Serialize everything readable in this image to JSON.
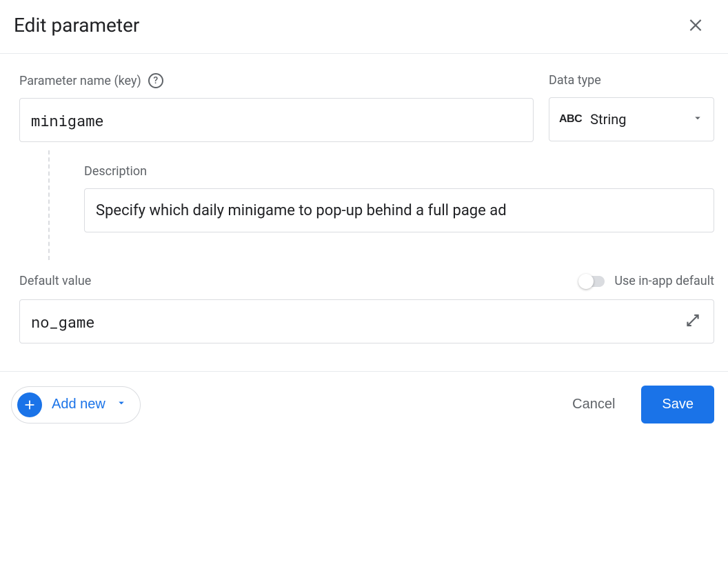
{
  "dialog": {
    "title": "Edit parameter"
  },
  "fields": {
    "param_name": {
      "label": "Parameter name (key)",
      "value": "minigame"
    },
    "data_type": {
      "label": "Data type",
      "icon_text": "ABC",
      "selected": "String"
    },
    "description": {
      "label": "Description",
      "value": "Specify which daily minigame to pop-up behind a full page ad"
    },
    "default_value": {
      "label": "Default value",
      "value": "no_game",
      "toggle_label": "Use in-app default",
      "toggle_on": false
    }
  },
  "footer": {
    "add_new": "Add new",
    "cancel": "Cancel",
    "save": "Save"
  }
}
